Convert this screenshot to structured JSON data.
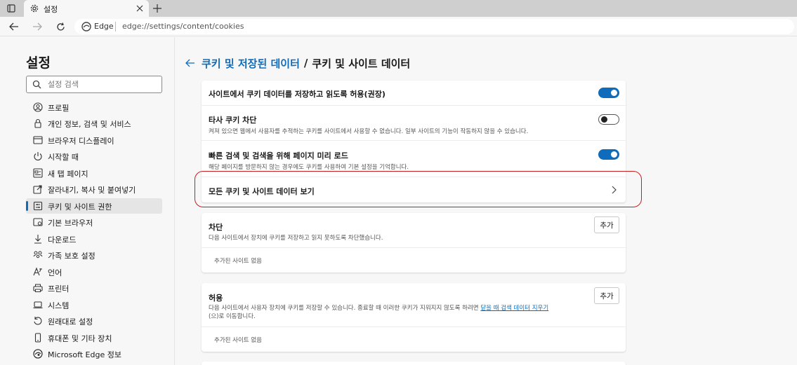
{
  "tab": {
    "title": "설정"
  },
  "address": {
    "browser_label": "Edge",
    "url": "edge://settings/content/cookies"
  },
  "sidebar": {
    "title": "설정",
    "search_placeholder": "설정 검색",
    "items": [
      {
        "label": "프로필",
        "icon": "profile-icon"
      },
      {
        "label": "개인 정보, 검색 및 서비스",
        "icon": "lock-icon"
      },
      {
        "label": "브라우저 디스플레이",
        "icon": "display-icon"
      },
      {
        "label": "시작할 때",
        "icon": "power-icon"
      },
      {
        "label": "새 탭 페이지",
        "icon": "new-tab-page-icon"
      },
      {
        "label": "잘라내기, 복사 및 붙여넣기",
        "icon": "share-icon"
      },
      {
        "label": "쿠키 및 사이트 권한",
        "icon": "cookie-permissions-icon"
      },
      {
        "label": "기본 브라우저",
        "icon": "default-browser-icon"
      },
      {
        "label": "다운로드",
        "icon": "download-icon"
      },
      {
        "label": "가족 보호 설정",
        "icon": "family-icon"
      },
      {
        "label": "언어",
        "icon": "language-icon"
      },
      {
        "label": "프린터",
        "icon": "printer-icon"
      },
      {
        "label": "시스템",
        "icon": "system-icon"
      },
      {
        "label": "원래대로 설정",
        "icon": "reset-icon"
      },
      {
        "label": "휴대폰 및 기타 장치",
        "icon": "phone-icon"
      },
      {
        "label": "Microsoft Edge 정보",
        "icon": "edge-icon"
      }
    ],
    "active_index": 6
  },
  "breadcrumb": {
    "parent": "쿠키 및 저장된 데이터",
    "separator": "/",
    "current": "쿠키 및 사이트 데이터"
  },
  "settings": {
    "allow_cookies": {
      "title": "사이트에서 쿠키 데이터를 저장하고 읽도록 허용(권장)",
      "enabled": true
    },
    "block_third_party": {
      "title": "타사 쿠키 차단",
      "desc": "켜져 있으면 웹에서 사용자를 추적하는 쿠키를 사이트에서 사용할 수 없습니다. 일부 사이트의 기능이 작동하지 않을 수 있습니다.",
      "enabled": false
    },
    "preload": {
      "title": "빠른 검색 및 검색을 위해 페이지 미리 로드",
      "desc": "해당 페이지를 방문하지 않는 경우에도 쿠키를 사용하여 기본 설정을 기억합니다.",
      "enabled": true
    },
    "see_all": {
      "title": "모든 쿠키 및 사이트 데이터 보기"
    }
  },
  "block": {
    "title": "차단",
    "desc": "다음 사이트에서 장치에 쿠키를 저장하고 읽지 못하도록 차단했습니다.",
    "add_label": "추가",
    "empty": "추가된 사이트 없음"
  },
  "allow": {
    "title": "허용",
    "desc_pre": "다음 사이트에서 사용자 장치에 쿠키를 저장할 수 있습니다. 종료할 때 이러한 쿠키가 지워지지 않도록 하려면 ",
    "desc_link": "닫을 때 검색 데이터 지우기",
    "desc_post": "(으)로 이동합니다.",
    "add_label": "추가",
    "empty": "추가된 사이트 없음"
  },
  "colors": {
    "accent": "#0f6cbd",
    "highlight": "#c81e1e"
  }
}
